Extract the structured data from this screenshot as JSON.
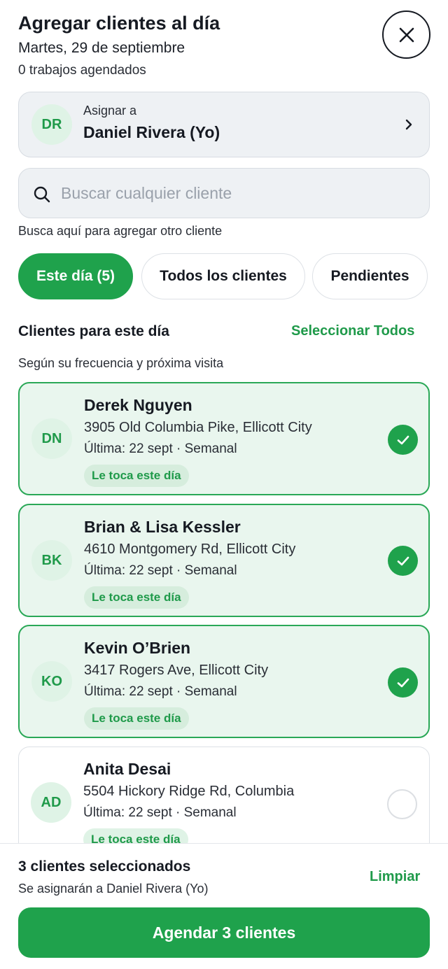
{
  "header": {
    "title": "Agregar clientes al día",
    "date": "Martes, 29 de septiembre",
    "jobs": "0 trabajos agendados",
    "close_icon": "close-icon"
  },
  "assign": {
    "initials": "DR",
    "label": "Asignar a",
    "name": "Daniel Rivera (Yo)",
    "chevron_icon": "chevron-right-icon"
  },
  "search": {
    "placeholder": "Buscar cualquier cliente",
    "value": "",
    "hint": "Busca aquí para agregar otro cliente"
  },
  "tabs": [
    {
      "label": "Este día (5)",
      "active": true
    },
    {
      "label": "Todos los clientes",
      "active": false
    },
    {
      "label": "Pendientes",
      "active": false
    }
  ],
  "section": {
    "title": "Clientes para este día",
    "select_all": "Seleccionar Todos",
    "subtitle": "Según su frecuencia y próxima visita"
  },
  "clients": [
    {
      "initials": "DN",
      "name": "Derek Nguyen",
      "address": "3905 Old Columbia Pike, Ellicott City",
      "meta": "Última: 22 sept · Semanal",
      "badge": "Le toca este día",
      "selected": true
    },
    {
      "initials": "BK",
      "name": "Brian & Lisa Kessler",
      "address": "4610 Montgomery Rd, Ellicott City",
      "meta": "Última: 22 sept · Semanal",
      "badge": "Le toca este día",
      "selected": true
    },
    {
      "initials": "KO",
      "name": "Kevin O’Brien",
      "address": "3417 Rogers Ave, Ellicott City",
      "meta": "Última: 22 sept · Semanal",
      "badge": "Le toca este día",
      "selected": true
    },
    {
      "initials": "AD",
      "name": "Anita Desai",
      "address": "5504 Hickory Ridge Rd, Columbia",
      "meta": "Última: 22 sept · Semanal",
      "badge": "Le toca este día",
      "selected": false
    }
  ],
  "footer": {
    "count": "3 clientes seleccionados",
    "assign_note": "Se asignarán a Daniel Rivera (Yo)",
    "clear": "Limpiar",
    "schedule": "Agendar 3 clientes"
  },
  "colors": {
    "accent": "#1fa24c",
    "selected_bg": "#e9f6ee",
    "avatar_bg": "#dff3e6"
  }
}
